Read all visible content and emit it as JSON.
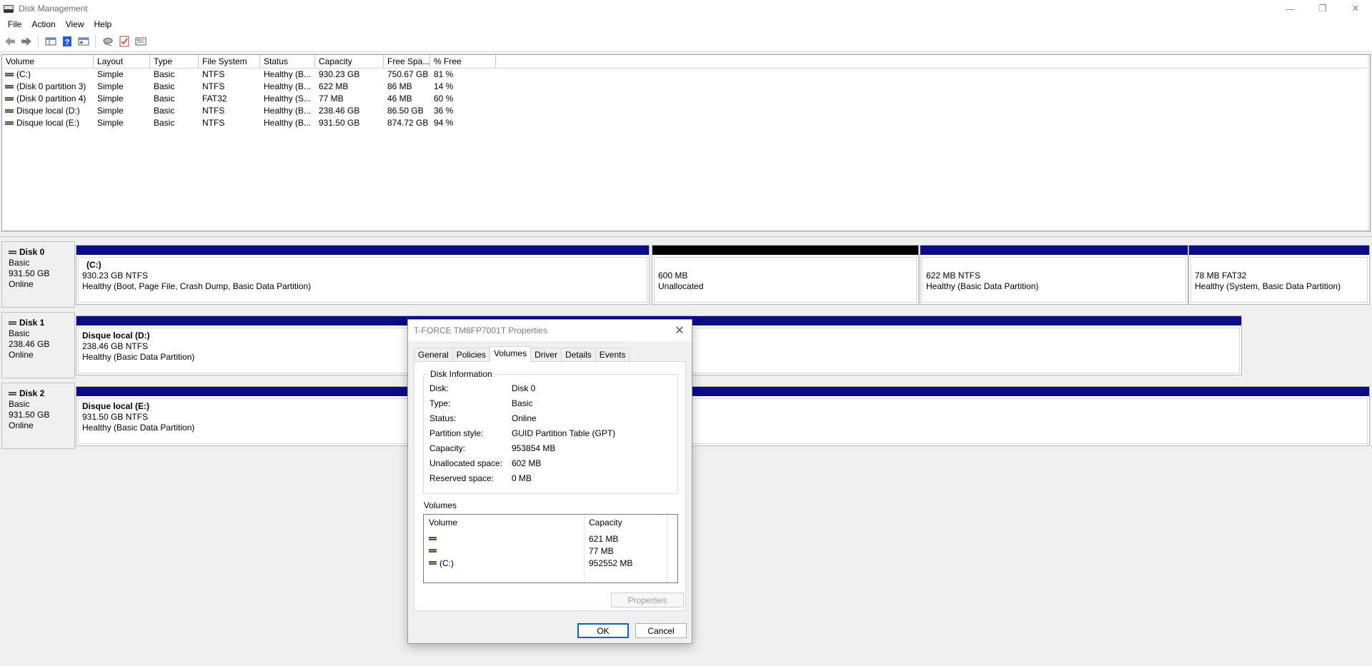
{
  "window": {
    "title": "Disk Management",
    "minimize": "—",
    "restore": "❐",
    "close": "✕"
  },
  "menu": [
    "File",
    "Action",
    "View",
    "Help"
  ],
  "toolbar": [
    "back-icon",
    "forward-icon",
    "show-hide-console-tree-icon",
    "help-icon",
    "properties-icon",
    "rescan-icon",
    "check-icon",
    "settings-icon"
  ],
  "volume_list": {
    "columns": [
      "Volume",
      "Layout",
      "Type",
      "File System",
      "Status",
      "Capacity",
      "Free Spa...",
      "% Free"
    ],
    "rows": [
      [
        "(C:)",
        "Simple",
        "Basic",
        "NTFS",
        "Healthy (B...",
        "930.23 GB",
        "750.67 GB",
        "81 %"
      ],
      [
        "(Disk 0 partition 3)",
        "Simple",
        "Basic",
        "NTFS",
        "Healthy (B...",
        "622 MB",
        "86 MB",
        "14 %"
      ],
      [
        "(Disk 0 partition 4)",
        "Simple",
        "Basic",
        "FAT32",
        "Healthy (S...",
        "77 MB",
        "46 MB",
        "60 %"
      ],
      [
        "Disque local (D:)",
        "Simple",
        "Basic",
        "NTFS",
        "Healthy (B...",
        "238.46 GB",
        "86.50 GB",
        "36 %"
      ],
      [
        "Disque local (E:)",
        "Simple",
        "Basic",
        "NTFS",
        "Healthy (B...",
        "931.50 GB",
        "874.72 GB",
        "94 %"
      ]
    ]
  },
  "disks": [
    {
      "name": "Disk 0",
      "type": "Basic",
      "size": "931.50 GB",
      "status": "Online",
      "partitions": [
        {
          "name": "(C:)",
          "size": "930.23 GB NTFS",
          "status": "Healthy (Boot, Page File, Crash Dump, Basic Data Partition)"
        },
        {
          "name": "",
          "size": "600 MB",
          "status": "Unallocated"
        },
        {
          "name": "",
          "size": "622 MB NTFS",
          "status": "Healthy (Basic Data Partition)"
        },
        {
          "name": "",
          "size": "78 MB FAT32",
          "status": "Healthy (System, Basic Data Partition)"
        }
      ]
    },
    {
      "name": "Disk 1",
      "type": "Basic",
      "size": "238.46 GB",
      "status": "Online",
      "partitions": [
        {
          "name": "Disque local  (D:)",
          "size": "238.46 GB NTFS",
          "status": "Healthy (Basic Data Partition)"
        }
      ]
    },
    {
      "name": "Disk 2",
      "type": "Basic",
      "size": "931.50 GB",
      "status": "Online",
      "partitions": [
        {
          "name": "Disque local  (E:)",
          "size": "931.50 GB NTFS",
          "status": "Healthy (Basic Data Partition)"
        }
      ]
    }
  ],
  "dialog": {
    "title": "T-FORCE TM8FP7001T Properties",
    "tabs": [
      "General",
      "Policies",
      "Volumes",
      "Driver",
      "Details",
      "Events"
    ],
    "active_tab": "Volumes",
    "disk_info_title": "Disk Information",
    "info": [
      [
        "Disk:",
        "Disk 0"
      ],
      [
        "Type:",
        "Basic"
      ],
      [
        "Status:",
        "Online"
      ],
      [
        "Partition style:",
        "GUID Partition Table (GPT)"
      ],
      [
        "Capacity:",
        "953854 MB"
      ],
      [
        "Unallocated space:",
        "602 MB"
      ],
      [
        "Reserved space:",
        "0 MB"
      ]
    ],
    "volumes_title": "Volumes",
    "volumes_columns": [
      "Volume",
      "Capacity"
    ],
    "volumes": [
      [
        "",
        "621 MB"
      ],
      [
        "",
        "77 MB"
      ],
      [
        "(C:)",
        "952552 MB"
      ]
    ],
    "properties_button": "Properties",
    "ok_button": "OK",
    "cancel_button": "Cancel"
  }
}
